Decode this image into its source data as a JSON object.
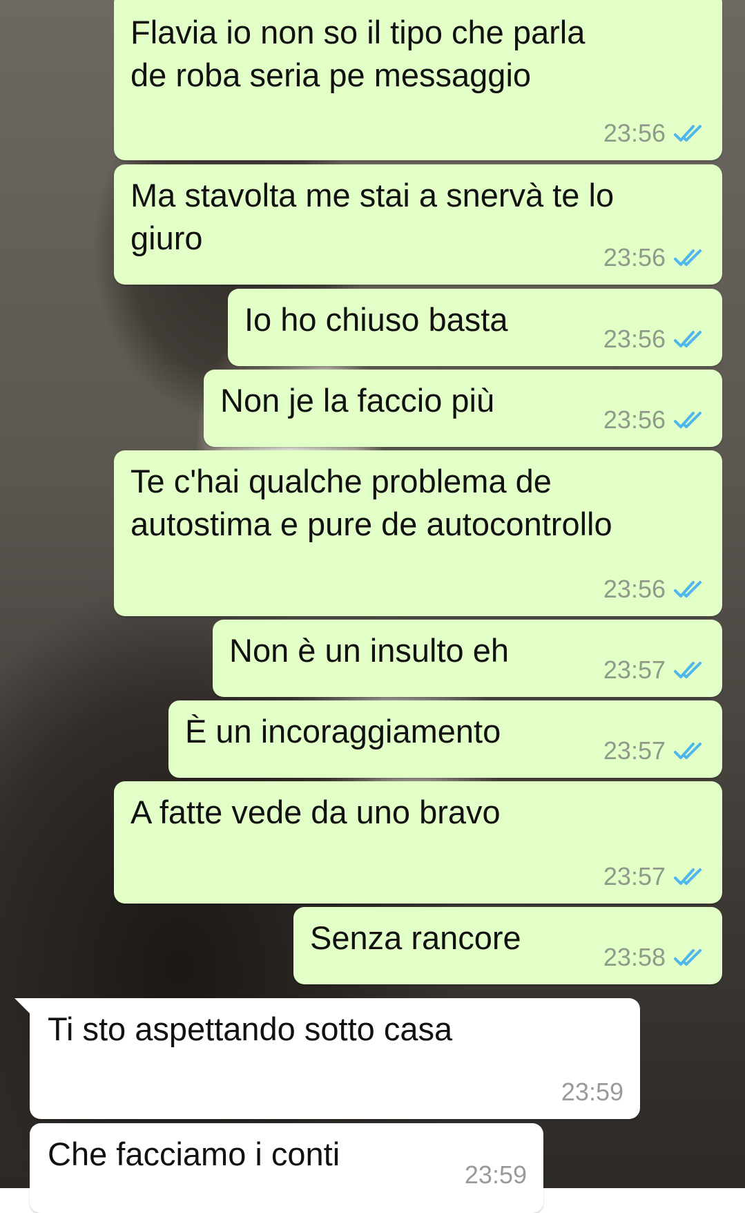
{
  "conversation": {
    "messages": [
      {
        "direction": "outgoing",
        "text": "Flavia io non so il tipo che parla\nde roba seria pe messaggio",
        "time": "23:56",
        "status": "read"
      },
      {
        "direction": "outgoing",
        "text": "Ma stavolta me stai a snervà te lo\ngiuro",
        "time": "23:56",
        "status": "read"
      },
      {
        "direction": "outgoing",
        "text": "Io ho chiuso basta",
        "time": "23:56",
        "status": "read"
      },
      {
        "direction": "outgoing",
        "text": "Non je la faccio più",
        "time": "23:56",
        "status": "read"
      },
      {
        "direction": "outgoing",
        "text": "Te c'hai qualche problema de\nautostima e pure de autocontrollo",
        "time": "23:56",
        "status": "read"
      },
      {
        "direction": "outgoing",
        "text": "Non è un insulto eh",
        "time": "23:57",
        "status": "read"
      },
      {
        "direction": "outgoing",
        "text": "È un incoraggiamento",
        "time": "23:57",
        "status": "read"
      },
      {
        "direction": "outgoing",
        "text": "A fatte vede da uno bravo",
        "time": "23:57",
        "status": "read"
      },
      {
        "direction": "outgoing",
        "text": "Senza rancore",
        "time": "23:58",
        "status": "read"
      },
      {
        "direction": "incoming",
        "text": "Ti sto aspettando sotto casa",
        "time": "23:59"
      },
      {
        "direction": "incoming",
        "text": "Che facciamo i conti",
        "time": "23:59"
      }
    ]
  },
  "icons": {
    "read_receipt": "double-check-icon"
  },
  "colors": {
    "outgoing_bubble": "#e1ffc7",
    "incoming_bubble": "#ffffff",
    "read_tick": "#4fb6ec"
  }
}
